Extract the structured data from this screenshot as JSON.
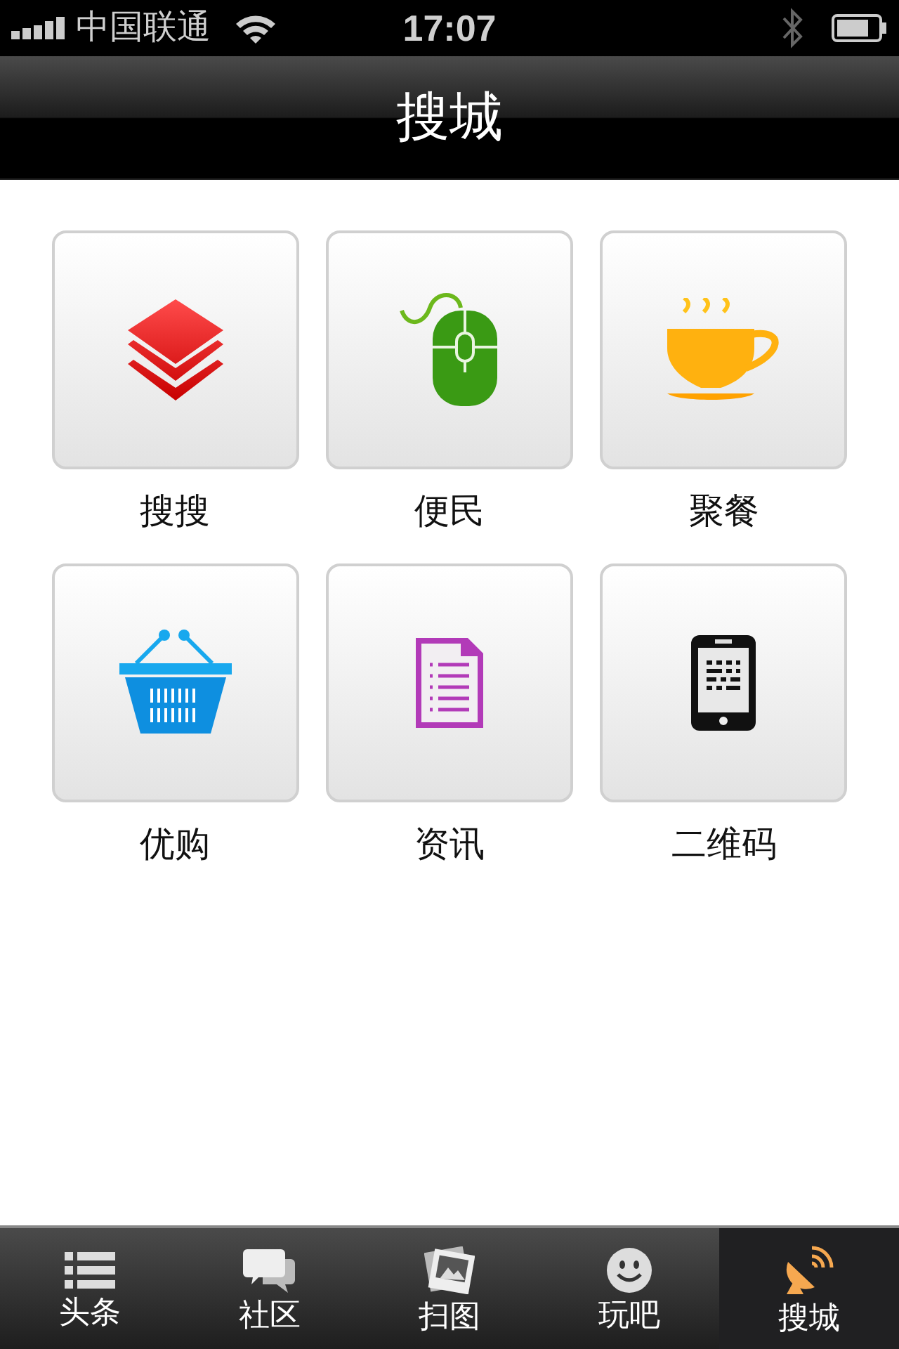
{
  "status_bar": {
    "carrier": "中国联通",
    "time": "17:07"
  },
  "nav_bar": {
    "title": "搜城"
  },
  "tiles": [
    {
      "label": "搜搜"
    },
    {
      "label": "便民"
    },
    {
      "label": "聚餐"
    },
    {
      "label": "优购"
    },
    {
      "label": "资讯"
    },
    {
      "label": "二维码"
    }
  ],
  "tabs": [
    {
      "label": "头条",
      "selected": false
    },
    {
      "label": "社区",
      "selected": false
    },
    {
      "label": "扫图",
      "selected": false
    },
    {
      "label": "玩吧",
      "selected": false
    },
    {
      "label": "搜城",
      "selected": true
    }
  ]
}
